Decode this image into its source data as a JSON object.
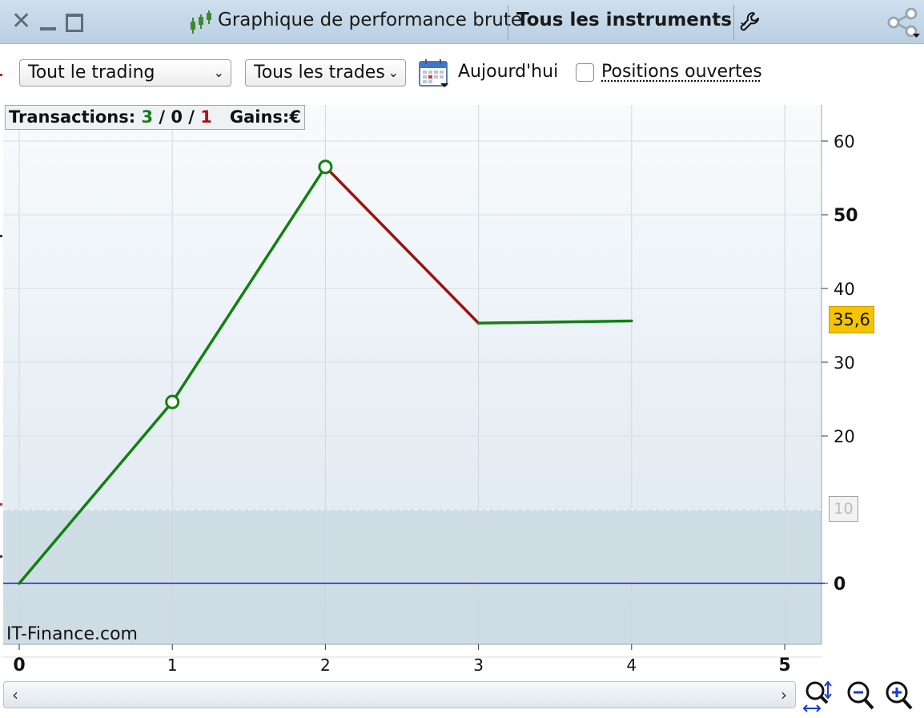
{
  "window": {
    "title": "Graphique de performance brute",
    "instrument_selector": "Tous les instruments"
  },
  "toolbar": {
    "trading_select": "Tout le trading",
    "trades_select": "Tous les trades",
    "today_label": "Aujourd'hui",
    "open_positions_label": "Positions ouvertes",
    "open_positions_checked": false
  },
  "stats": {
    "transactions_label": "Transactions:",
    "winning": "3",
    "neutral": "0",
    "losing": "1",
    "gains_label": "Gains:",
    "currency": "€"
  },
  "branding": "IT-Finance.com",
  "chart_data": {
    "type": "line",
    "x": [
      0,
      1,
      2,
      3,
      4
    ],
    "y": [
      0,
      24.6,
      56.5,
      35.3,
      35.6
    ],
    "segment_colors": [
      "#118011",
      "#118011",
      "#a01010",
      "#118011"
    ],
    "trade_markers_x": [
      1,
      2
    ],
    "xlim": [
      0,
      5.2
    ],
    "ylim": [
      -13,
      65
    ],
    "x_ticks": [
      "0",
      "1",
      "2",
      "3",
      "4",
      "5"
    ],
    "x_ticks_bold": [
      "0",
      "5"
    ],
    "y_ticks": [
      "60",
      "50",
      "40",
      "30",
      "20",
      "0"
    ],
    "y_ticks_bold": [
      "50",
      "0"
    ],
    "last_value_label": "35,6",
    "reference_line_value": 10,
    "reference_label": "10",
    "zero_line_color": "#2222cc",
    "grid": true
  },
  "colors": {
    "gain": "#118011",
    "loss": "#a01010",
    "last_value_bg": "#f5c400"
  }
}
